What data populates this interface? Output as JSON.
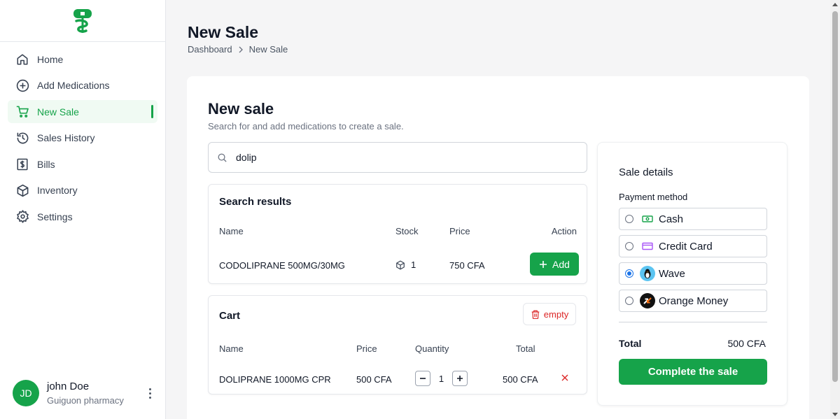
{
  "sidebar": {
    "items": [
      {
        "label": "Home",
        "icon": "home-icon"
      },
      {
        "label": "Add Medications",
        "icon": "plus-circle-icon"
      },
      {
        "label": "New Sale",
        "icon": "cart-icon",
        "active": true
      },
      {
        "label": "Sales History",
        "icon": "history-icon"
      },
      {
        "label": "Bills",
        "icon": "dollar-bill-icon"
      },
      {
        "label": "Inventory",
        "icon": "box-icon"
      },
      {
        "label": "Settings",
        "icon": "gear-icon"
      }
    ],
    "user": {
      "initials": "JD",
      "name": "john Doe",
      "org": "Guiguon pharmacy"
    }
  },
  "header": {
    "title": "New Sale",
    "breadcrumb": [
      "Dashboard",
      "New Sale"
    ]
  },
  "main": {
    "title": "New sale",
    "subtitle": "Search for and add medications to create a sale.",
    "search": {
      "value": "dolip",
      "icon": "search-icon"
    },
    "results": {
      "title": "Search results",
      "columns": [
        "Name",
        "Stock",
        "Price",
        "Action"
      ],
      "rows": [
        {
          "name": "CODOLIPRANE 500MG/30MG",
          "stock": "1",
          "price": "750 CFA",
          "action": "Add"
        }
      ]
    },
    "cart": {
      "title": "Cart",
      "empty_label": "empty",
      "columns": [
        "Name",
        "Price",
        "Quantity",
        "Total"
      ],
      "rows": [
        {
          "name": "DOLIPRANE 1000MG CPR",
          "price": "500 CFA",
          "quantity": "1",
          "total": "500 CFA"
        }
      ]
    }
  },
  "sale_details": {
    "title": "Sale details",
    "payment_label": "Payment method",
    "methods": [
      {
        "label": "Cash",
        "icon": "cash-icon",
        "selected": false
      },
      {
        "label": "Credit Card",
        "icon": "credit-card-icon",
        "selected": false
      },
      {
        "label": "Wave",
        "icon": "wave-logo-icon",
        "selected": true
      },
      {
        "label": "Orange Money",
        "icon": "orange-money-logo-icon",
        "selected": false
      }
    ],
    "total_label": "Total",
    "total_value": "500 CFA",
    "complete_label": "Complete the sale"
  },
  "colors": {
    "brand": "#16a34a",
    "danger": "#dc2626",
    "radio": "#1a73e8"
  }
}
